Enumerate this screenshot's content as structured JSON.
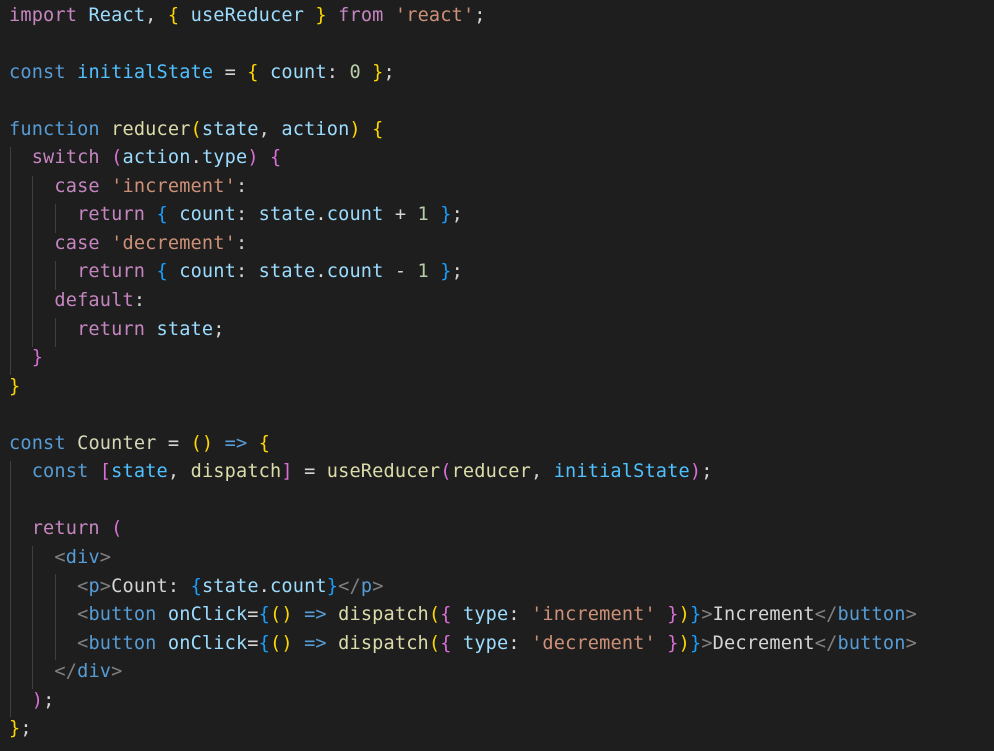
{
  "editor": {
    "language": "javascript-react",
    "theme_colors": {
      "background": "#1e1e1e",
      "keyword_control": "#C586C0",
      "storage": "#569CD6",
      "variable": "#9CDCFE",
      "constant": "#4FC1FF",
      "function": "#DCDCAA",
      "string": "#CE9178",
      "number": "#B5CEA8",
      "bracket_level_1": "#FFD700",
      "bracket_level_2": "#DA70D6",
      "bracket_level_3": "#179FFF",
      "tag_punctuation": "#808080",
      "tag_name": "#569CD6"
    },
    "lines": [
      {
        "tokens": [
          [
            "kw",
            "import"
          ],
          [
            "pl",
            " "
          ],
          [
            "vr",
            "React"
          ],
          [
            "pl",
            ", "
          ],
          [
            "b1",
            "{"
          ],
          [
            "pl",
            " "
          ],
          [
            "vr",
            "useReducer"
          ],
          [
            "pl",
            " "
          ],
          [
            "b1",
            "}"
          ],
          [
            "pl",
            " "
          ],
          [
            "kw",
            "from"
          ],
          [
            "pl",
            " "
          ],
          [
            "sg",
            "'react'"
          ],
          [
            "pl",
            ";"
          ]
        ]
      },
      {
        "tokens": []
      },
      {
        "tokens": [
          [
            "st",
            "const"
          ],
          [
            "pl",
            " "
          ],
          [
            "cv",
            "initialState"
          ],
          [
            "pl",
            " = "
          ],
          [
            "b1",
            "{"
          ],
          [
            "pl",
            " "
          ],
          [
            "vr",
            "count"
          ],
          [
            "pl",
            ": "
          ],
          [
            "nm",
            "0"
          ],
          [
            "pl",
            " "
          ],
          [
            "b1",
            "}"
          ],
          [
            "pl",
            ";"
          ]
        ]
      },
      {
        "tokens": []
      },
      {
        "tokens": [
          [
            "st",
            "function"
          ],
          [
            "pl",
            " "
          ],
          [
            "fn",
            "reducer"
          ],
          [
            "b1",
            "("
          ],
          [
            "vr",
            "state"
          ],
          [
            "pl",
            ", "
          ],
          [
            "vr",
            "action"
          ],
          [
            "b1",
            ")"
          ],
          [
            "pl",
            " "
          ],
          [
            "b1",
            "{"
          ]
        ]
      },
      {
        "tokens": [
          [
            "pl",
            "  "
          ],
          [
            "kw",
            "switch"
          ],
          [
            "pl",
            " "
          ],
          [
            "b2",
            "("
          ],
          [
            "vr",
            "action"
          ],
          [
            "pl",
            "."
          ],
          [
            "vr",
            "type"
          ],
          [
            "b2",
            ")"
          ],
          [
            "pl",
            " "
          ],
          [
            "b2",
            "{"
          ]
        ]
      },
      {
        "tokens": [
          [
            "pl",
            "    "
          ],
          [
            "kw",
            "case"
          ],
          [
            "pl",
            " "
          ],
          [
            "sg",
            "'increment'"
          ],
          [
            "pl",
            ":"
          ]
        ]
      },
      {
        "tokens": [
          [
            "pl",
            "      "
          ],
          [
            "kw",
            "return"
          ],
          [
            "pl",
            " "
          ],
          [
            "b3",
            "{"
          ],
          [
            "pl",
            " "
          ],
          [
            "vr",
            "count"
          ],
          [
            "pl",
            ": "
          ],
          [
            "vr",
            "state"
          ],
          [
            "pl",
            "."
          ],
          [
            "vr",
            "count"
          ],
          [
            "pl",
            " + "
          ],
          [
            "nm",
            "1"
          ],
          [
            "pl",
            " "
          ],
          [
            "b3",
            "}"
          ],
          [
            "pl",
            ";"
          ]
        ]
      },
      {
        "tokens": [
          [
            "pl",
            "    "
          ],
          [
            "kw",
            "case"
          ],
          [
            "pl",
            " "
          ],
          [
            "sg",
            "'decrement'"
          ],
          [
            "pl",
            ":"
          ]
        ]
      },
      {
        "tokens": [
          [
            "pl",
            "      "
          ],
          [
            "kw",
            "return"
          ],
          [
            "pl",
            " "
          ],
          [
            "b3",
            "{"
          ],
          [
            "pl",
            " "
          ],
          [
            "vr",
            "count"
          ],
          [
            "pl",
            ": "
          ],
          [
            "vr",
            "state"
          ],
          [
            "pl",
            "."
          ],
          [
            "vr",
            "count"
          ],
          [
            "pl",
            " - "
          ],
          [
            "nm",
            "1"
          ],
          [
            "pl",
            " "
          ],
          [
            "b3",
            "}"
          ],
          [
            "pl",
            ";"
          ]
        ]
      },
      {
        "tokens": [
          [
            "pl",
            "    "
          ],
          [
            "kw",
            "default"
          ],
          [
            "pl",
            ":"
          ]
        ]
      },
      {
        "tokens": [
          [
            "pl",
            "      "
          ],
          [
            "kw",
            "return"
          ],
          [
            "pl",
            " "
          ],
          [
            "vr",
            "state"
          ],
          [
            "pl",
            ";"
          ]
        ]
      },
      {
        "tokens": [
          [
            "pl",
            "  "
          ],
          [
            "b2",
            "}"
          ]
        ]
      },
      {
        "tokens": [
          [
            "b1",
            "}"
          ]
        ]
      },
      {
        "tokens": []
      },
      {
        "tokens": [
          [
            "st",
            "const"
          ],
          [
            "pl",
            " "
          ],
          [
            "cl",
            "Counter"
          ],
          [
            "pl",
            " = "
          ],
          [
            "b1",
            "()"
          ],
          [
            "pl",
            " "
          ],
          [
            "st",
            "=>"
          ],
          [
            "pl",
            " "
          ],
          [
            "b1",
            "{"
          ]
        ]
      },
      {
        "tokens": [
          [
            "pl",
            "  "
          ],
          [
            "st",
            "const"
          ],
          [
            "pl",
            " "
          ],
          [
            "b2",
            "["
          ],
          [
            "cv",
            "state"
          ],
          [
            "pl",
            ", "
          ],
          [
            "fn",
            "dispatch"
          ],
          [
            "b2",
            "]"
          ],
          [
            "pl",
            " = "
          ],
          [
            "fn",
            "useReducer"
          ],
          [
            "b2",
            "("
          ],
          [
            "fn",
            "reducer"
          ],
          [
            "pl",
            ", "
          ],
          [
            "cv",
            "initialState"
          ],
          [
            "b2",
            ")"
          ],
          [
            "pl",
            ";"
          ]
        ]
      },
      {
        "tokens": []
      },
      {
        "tokens": [
          [
            "pl",
            "  "
          ],
          [
            "kw",
            "return"
          ],
          [
            "pl",
            " "
          ],
          [
            "b2",
            "("
          ]
        ]
      },
      {
        "tokens": [
          [
            "pl",
            "    "
          ],
          [
            "tp",
            "<"
          ],
          [
            "tg",
            "div"
          ],
          [
            "tp",
            ">"
          ]
        ]
      },
      {
        "tokens": [
          [
            "pl",
            "      "
          ],
          [
            "tp",
            "<"
          ],
          [
            "tg",
            "p"
          ],
          [
            "tp",
            ">"
          ],
          [
            "tx",
            "Count: "
          ],
          [
            "b3",
            "{"
          ],
          [
            "vr",
            "state"
          ],
          [
            "pl",
            "."
          ],
          [
            "vr",
            "count"
          ],
          [
            "b3",
            "}"
          ],
          [
            "tp",
            "</"
          ],
          [
            "tg",
            "p"
          ],
          [
            "tp",
            ">"
          ]
        ]
      },
      {
        "tokens": [
          [
            "pl",
            "      "
          ],
          [
            "tp",
            "<"
          ],
          [
            "tg",
            "button"
          ],
          [
            "pl",
            " "
          ],
          [
            "vr",
            "onClick"
          ],
          [
            "pl",
            "="
          ],
          [
            "b3",
            "{"
          ],
          [
            "b1",
            "()"
          ],
          [
            "pl",
            " "
          ],
          [
            "st",
            "=>"
          ],
          [
            "pl",
            " "
          ],
          [
            "fn",
            "dispatch"
          ],
          [
            "b1",
            "("
          ],
          [
            "b2",
            "{"
          ],
          [
            "pl",
            " "
          ],
          [
            "vr",
            "type"
          ],
          [
            "pl",
            ": "
          ],
          [
            "sg",
            "'increment'"
          ],
          [
            "pl",
            " "
          ],
          [
            "b2",
            "}"
          ],
          [
            "b1",
            ")"
          ],
          [
            "b3",
            "}"
          ],
          [
            "tp",
            ">"
          ],
          [
            "tx",
            "Increment"
          ],
          [
            "tp",
            "</"
          ],
          [
            "tg",
            "button"
          ],
          [
            "tp",
            ">"
          ]
        ]
      },
      {
        "tokens": [
          [
            "pl",
            "      "
          ],
          [
            "tp",
            "<"
          ],
          [
            "tg",
            "button"
          ],
          [
            "pl",
            " "
          ],
          [
            "vr",
            "onClick"
          ],
          [
            "pl",
            "="
          ],
          [
            "b3",
            "{"
          ],
          [
            "b1",
            "()"
          ],
          [
            "pl",
            " "
          ],
          [
            "st",
            "=>"
          ],
          [
            "pl",
            " "
          ],
          [
            "fn",
            "dispatch"
          ],
          [
            "b1",
            "("
          ],
          [
            "b2",
            "{"
          ],
          [
            "pl",
            " "
          ],
          [
            "vr",
            "type"
          ],
          [
            "pl",
            ": "
          ],
          [
            "sg",
            "'decrement'"
          ],
          [
            "pl",
            " "
          ],
          [
            "b2",
            "}"
          ],
          [
            "b1",
            ")"
          ],
          [
            "b3",
            "}"
          ],
          [
            "tp",
            ">"
          ],
          [
            "tx",
            "Decrement"
          ],
          [
            "tp",
            "</"
          ],
          [
            "tg",
            "button"
          ],
          [
            "tp",
            ">"
          ]
        ]
      },
      {
        "tokens": [
          [
            "pl",
            "    "
          ],
          [
            "tp",
            "</"
          ],
          [
            "tg",
            "div"
          ],
          [
            "tp",
            ">"
          ]
        ]
      },
      {
        "tokens": [
          [
            "pl",
            "  "
          ],
          [
            "b2",
            ")"
          ],
          [
            "pl",
            ";"
          ]
        ]
      },
      {
        "tokens": [
          [
            "b1",
            "}"
          ],
          [
            "pl",
            ";"
          ]
        ]
      }
    ]
  }
}
